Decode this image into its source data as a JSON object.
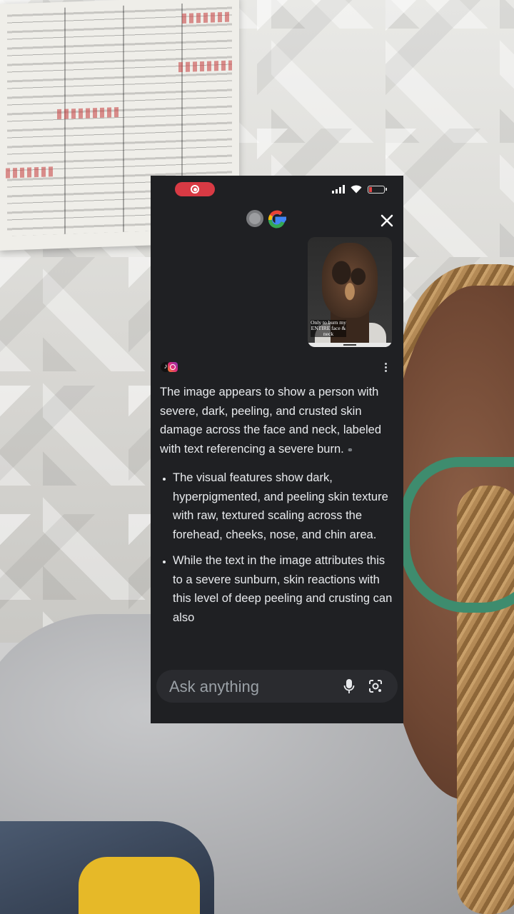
{
  "assistant": {
    "thumbnail_caption": "Only to burn my ENTIRE face & neck",
    "answer_intro": "The image appears to show a person with severe, dark, peeling, and crusted skin damage across the face and neck, labeled with text referencing a severe burn.",
    "bullets": [
      "The visual features show dark, hyperpigmented, and peeling skin texture with raw, textured scaling across the forehead, cheeks, nose, and chin area.",
      "While the text in the image attributes this to a severe sunburn, skin reactions with this level of deep peeling and crusting can also"
    ]
  },
  "ask_bar": {
    "placeholder": "Ask anything"
  },
  "icons": {
    "record": "screen-record-icon",
    "signal": "signal-icon",
    "wifi": "wifi-icon",
    "battery": "battery-icon",
    "google": "google-logo",
    "close": "close-icon",
    "tiktok": "tiktok-icon",
    "instagram": "instagram-icon",
    "more": "more-vert-icon",
    "link": "link-icon",
    "mic": "mic-icon",
    "lens": "google-lens-icon"
  },
  "colors": {
    "panel_bg": "#1f2023",
    "text": "#e8eaed",
    "muted": "#9aa0a6",
    "record_red": "#d83a44",
    "battery_low": "#e04545"
  }
}
